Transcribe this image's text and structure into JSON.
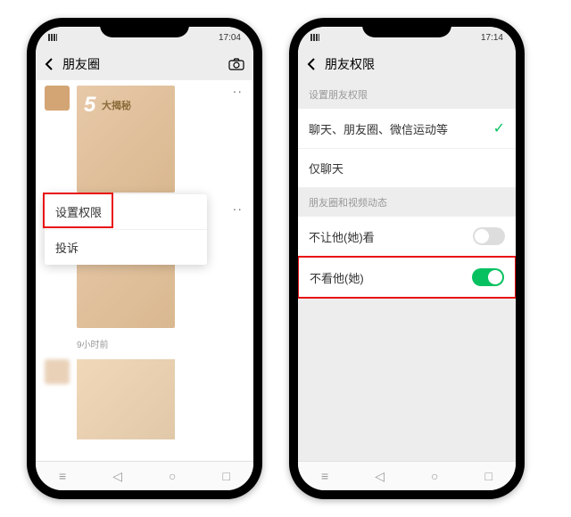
{
  "left": {
    "status_time": "17:04",
    "nav_title": "朋友圈",
    "banner": {
      "big": "5",
      "chars": "大揭秘"
    },
    "menu": {
      "set_permission": "设置权限",
      "report": "投诉"
    },
    "time_text": "9小时前"
  },
  "right": {
    "status_time": "17:14",
    "nav_title": "朋友权限",
    "section1_header": "设置朋友权限",
    "opt_all": "聊天、朋友圈、微信运动等",
    "opt_chat": "仅聊天",
    "section2_header": "朋友圈和视频动态",
    "row_block_them": "不让他(她)看",
    "row_hide_them": "不看他(她)"
  }
}
